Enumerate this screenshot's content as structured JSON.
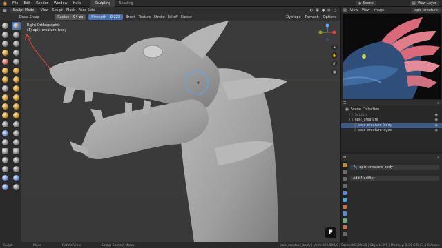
{
  "top_menu": [
    "File",
    "Edit",
    "Render",
    "Window",
    "Help"
  ],
  "workspaces": [
    {
      "label": "Sculpting",
      "active": true
    },
    {
      "label": "Shading",
      "active": false
    }
  ],
  "top_right": {
    "scene_label": "Scene",
    "view_layer_label": "View Layer"
  },
  "header": {
    "mode": "Sculpt Mode",
    "menus": [
      "View",
      "Sculpt",
      "Mask",
      "Face Sets"
    ]
  },
  "tool_settings": {
    "brush_name": "Draw Sharp",
    "radius_label": "Radius",
    "radius_value": "94 px",
    "strength_label": "Strength",
    "strength_value": "0.323",
    "menus": [
      "Brush",
      "Texture",
      "Stroke",
      "Falloff",
      "Cursor"
    ],
    "right_menus": [
      "Dyntopo",
      "Remesh",
      "Options"
    ]
  },
  "viewport": {
    "view_name": "Right Orthographic",
    "object_label": "(1) epic_creature_body",
    "badge": "F"
  },
  "image_editor": {
    "menus": [
      "View",
      "View",
      "Image"
    ],
    "image_name": "epic_creature"
  },
  "outliner": {
    "rows": [
      {
        "label": "Scene Collection",
        "indent": 0,
        "selected": false,
        "dim": false
      },
      {
        "label": "Sculpts",
        "indent": 1,
        "selected": false,
        "dim": true
      },
      {
        "label": "epic_creature",
        "indent": 1,
        "selected": false,
        "dim": false
      },
      {
        "label": "epic_creature_body",
        "indent": 2,
        "selected": true,
        "dim": false
      },
      {
        "label": "epic_creature_eyes",
        "indent": 2,
        "selected": false,
        "dim": false
      }
    ]
  },
  "properties": {
    "object_name": "epic_creature_body",
    "add_modifier": "Add Modifier"
  },
  "statusbar": {
    "items": [
      "Sculpt",
      "Move",
      "Rotate View",
      "Sculpt Context Menu"
    ],
    "stats": "epic_creature_body | Verts:802,894/0 | Faces:802,894/0 | Objects:0/1 | Memory: 1.39 GiB | 3.1.0 Alpha"
  }
}
